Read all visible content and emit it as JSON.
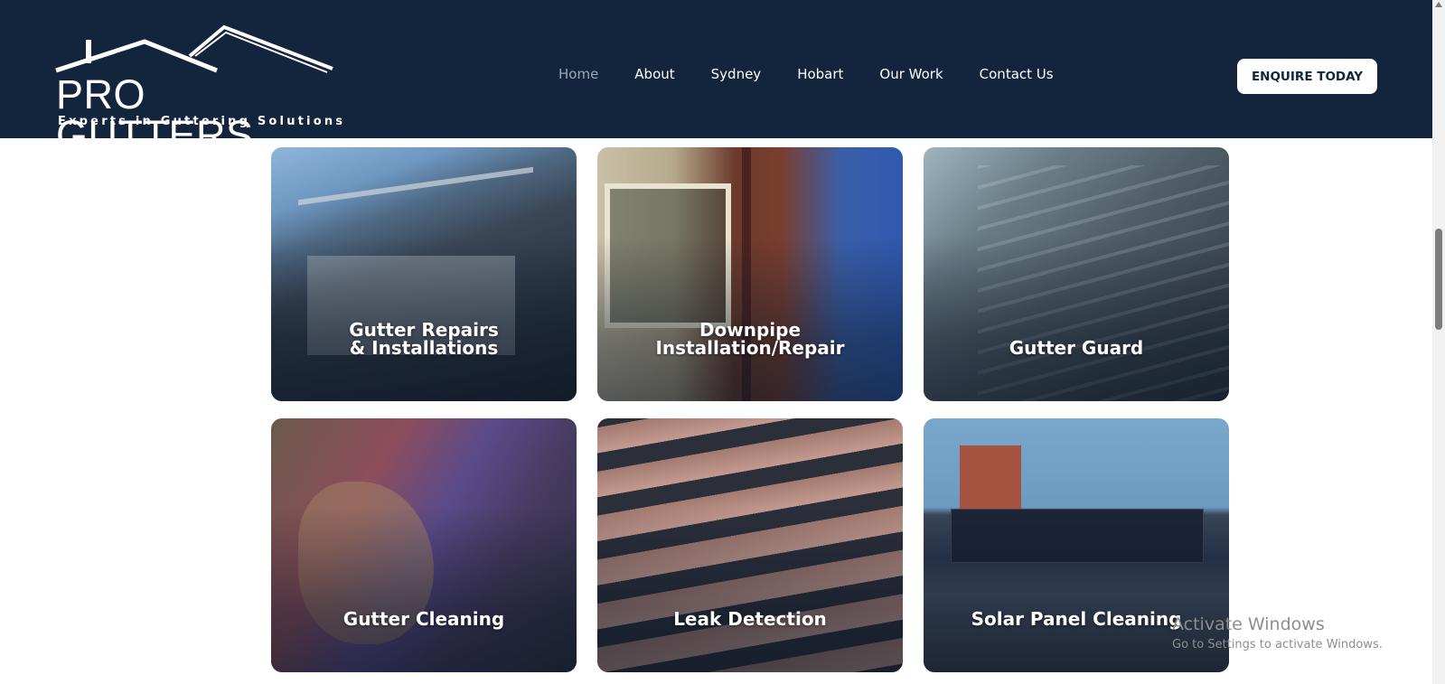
{
  "brand": {
    "name": "PRO GUTTERS",
    "tagline": "Experts in Guttering Solutions"
  },
  "nav": {
    "items": [
      {
        "label": "Home",
        "active": true
      },
      {
        "label": "About",
        "active": false
      },
      {
        "label": "Sydney",
        "active": false
      },
      {
        "label": "Hobart",
        "active": false
      },
      {
        "label": "Our Work",
        "active": false
      },
      {
        "label": "Contact Us",
        "active": false
      }
    ],
    "cta_label": "ENQUIRE TODAY"
  },
  "services": [
    {
      "label": "Gutter Repairs\n& Installations"
    },
    {
      "label": "Downpipe\nInstallation/Repair"
    },
    {
      "label": "Gutter Guard"
    },
    {
      "label": "Gutter Cleaning"
    },
    {
      "label": "Leak Detection"
    },
    {
      "label": "Solar Panel Cleaning"
    }
  ],
  "watermark": {
    "title": "Activate Windows",
    "subtitle": "Go to Settings to activate Windows."
  },
  "colors": {
    "header_bg": "#13253d",
    "nav_active": "#9aa8b8",
    "cta_bg": "#ffffff",
    "cta_text": "#13253d"
  }
}
